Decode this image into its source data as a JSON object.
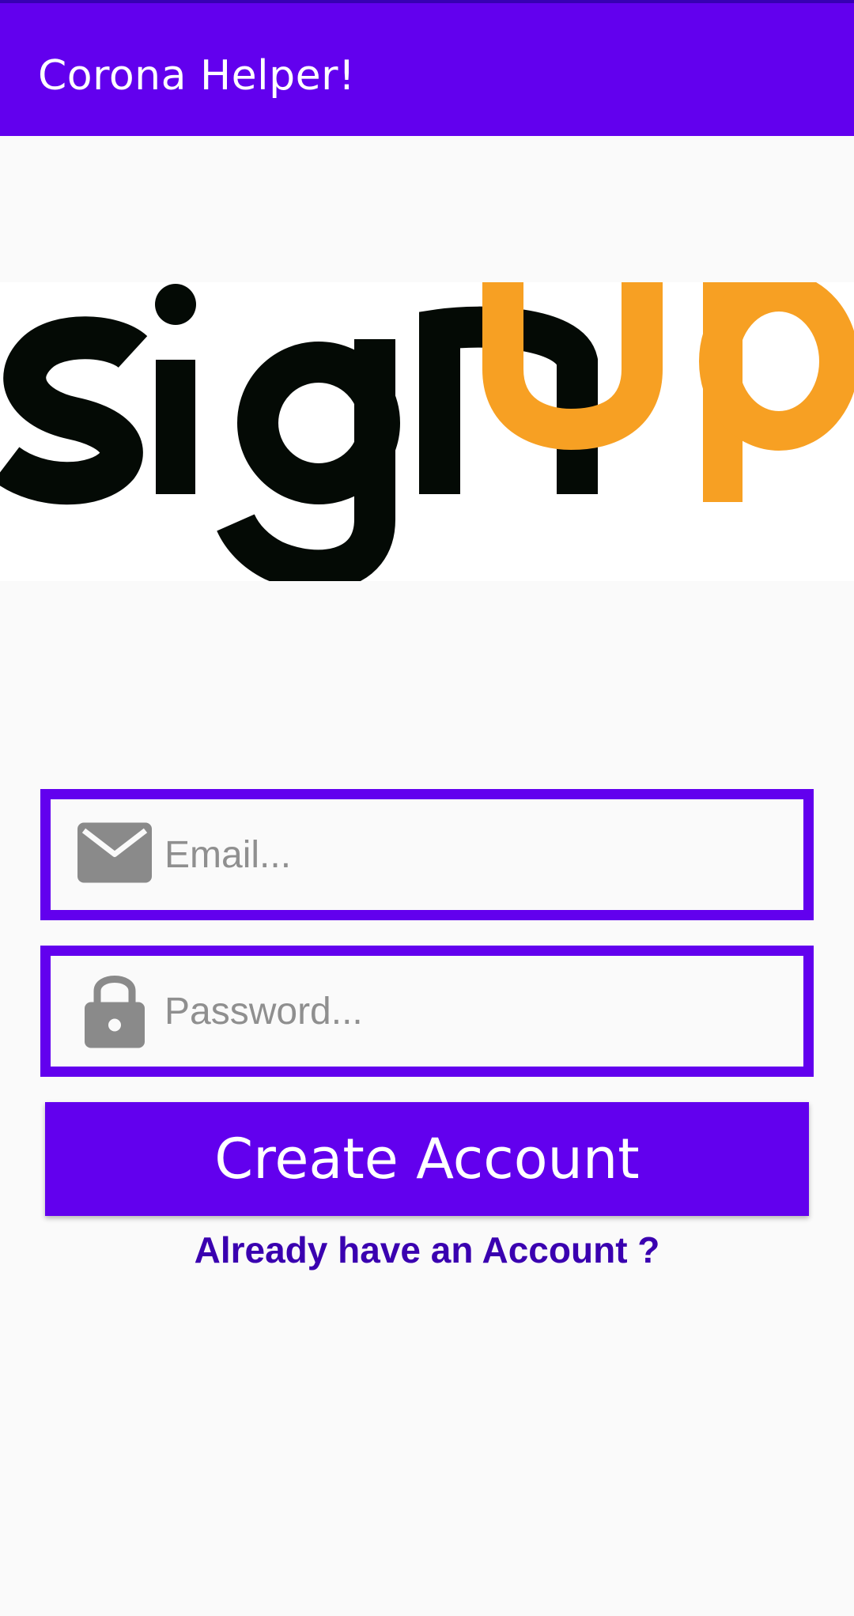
{
  "app_bar": {
    "title": "Corona Helper!"
  },
  "logo": {
    "word_part1": "sign",
    "word_part2": "up",
    "dark_color": "#040a05",
    "accent_color": "#f7a023"
  },
  "form": {
    "email": {
      "placeholder": "Email...",
      "value": "",
      "icon": "mail-icon"
    },
    "password": {
      "placeholder": "Password...",
      "value": "",
      "icon": "lock-icon"
    },
    "create_button_label": "Create Account",
    "login_link_label": "Already have an Account ?"
  },
  "colors": {
    "primary": "#6200ee",
    "primary_dark": "#3700b3",
    "link": "#3a00b0",
    "background": "#fafafa"
  }
}
